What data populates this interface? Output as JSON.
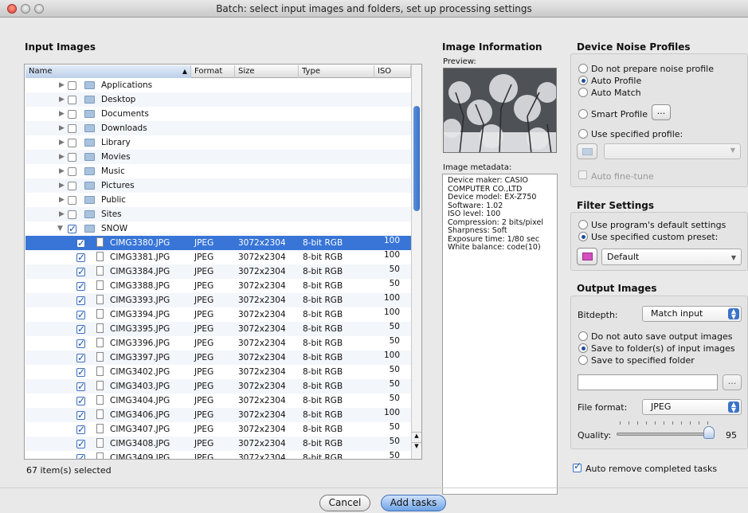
{
  "window": {
    "title": "Batch: select input images and folders, set up processing settings"
  },
  "input_images": {
    "title": "Input Images",
    "columns": [
      "Name",
      "Format",
      "Size",
      "Type",
      "ISO"
    ],
    "folders": [
      {
        "name": "Applications"
      },
      {
        "name": "Desktop"
      },
      {
        "name": "Documents"
      },
      {
        "name": "Downloads"
      },
      {
        "name": "Library"
      },
      {
        "name": "Movies"
      },
      {
        "name": "Music"
      },
      {
        "name": "Pictures"
      },
      {
        "name": "Public"
      },
      {
        "name": "Sites"
      },
      {
        "name": "SNOW"
      }
    ],
    "files": [
      {
        "name": "CIMG3380.JPG",
        "format": "JPEG",
        "size": "3072x2304",
        "type": "8-bit RGB",
        "iso": "100"
      },
      {
        "name": "CIMG3381.JPG",
        "format": "JPEG",
        "size": "3072x2304",
        "type": "8-bit RGB",
        "iso": "100"
      },
      {
        "name": "CIMG3384.JPG",
        "format": "JPEG",
        "size": "3072x2304",
        "type": "8-bit RGB",
        "iso": "50"
      },
      {
        "name": "CIMG3388.JPG",
        "format": "JPEG",
        "size": "3072x2304",
        "type": "8-bit RGB",
        "iso": "50"
      },
      {
        "name": "CIMG3393.JPG",
        "format": "JPEG",
        "size": "3072x2304",
        "type": "8-bit RGB",
        "iso": "100"
      },
      {
        "name": "CIMG3394.JPG",
        "format": "JPEG",
        "size": "3072x2304",
        "type": "8-bit RGB",
        "iso": "100"
      },
      {
        "name": "CIMG3395.JPG",
        "format": "JPEG",
        "size": "3072x2304",
        "type": "8-bit RGB",
        "iso": "50"
      },
      {
        "name": "CIMG3396.JPG",
        "format": "JPEG",
        "size": "3072x2304",
        "type": "8-bit RGB",
        "iso": "50"
      },
      {
        "name": "CIMG3397.JPG",
        "format": "JPEG",
        "size": "3072x2304",
        "type": "8-bit RGB",
        "iso": "100"
      },
      {
        "name": "CIMG3402.JPG",
        "format": "JPEG",
        "size": "3072x2304",
        "type": "8-bit RGB",
        "iso": "50"
      },
      {
        "name": "CIMG3403.JPG",
        "format": "JPEG",
        "size": "3072x2304",
        "type": "8-bit RGB",
        "iso": "50"
      },
      {
        "name": "CIMG3404.JPG",
        "format": "JPEG",
        "size": "3072x2304",
        "type": "8-bit RGB",
        "iso": "50"
      },
      {
        "name": "CIMG3406.JPG",
        "format": "JPEG",
        "size": "3072x2304",
        "type": "8-bit RGB",
        "iso": "100"
      },
      {
        "name": "CIMG3407.JPG",
        "format": "JPEG",
        "size": "3072x2304",
        "type": "8-bit RGB",
        "iso": "50"
      },
      {
        "name": "CIMG3408.JPG",
        "format": "JPEG",
        "size": "3072x2304",
        "type": "8-bit RGB",
        "iso": "50"
      }
    ],
    "partial_row": {
      "name": "CIMG3409.JPG",
      "format": "JPEG",
      "size": "3072x2304",
      "type": "8-bit RGB",
      "iso": "50"
    },
    "status": "67 item(s) selected"
  },
  "image_info": {
    "title": "Image Information",
    "preview_label": "Preview:",
    "metadata_label": "Image metadata:",
    "metadata": [
      "Device maker: CASIO",
      "COMPUTER CO.,LTD",
      "Device model: EX-Z750",
      "Software: 1.02",
      "ISO level: 100",
      "Compression: 2 bits/pixel",
      "Sharpness: Soft",
      "Exposure time: 1/80 sec",
      "White balance: code(10)"
    ]
  },
  "noise": {
    "title": "Device Noise Profiles",
    "options": [
      "Do not prepare noise profile",
      "Auto Profile",
      "Auto Match"
    ],
    "smart_profile": "Smart Profile",
    "use_specified": "Use specified profile:",
    "ellipsis": "...",
    "auto_fine_tune": "Auto fine-tune"
  },
  "filter": {
    "title": "Filter Settings",
    "options": [
      "Use program's default settings",
      "Use specified custom preset:"
    ],
    "preset": "Default"
  },
  "output": {
    "title": "Output Images",
    "bitdepth_label": "Bitdepth:",
    "bitdepth_value": "Match input",
    "save_options": [
      "Do not auto save output images",
      "Save to folder(s) of input images",
      "Save to specified folder"
    ],
    "folder_path": "",
    "browse": "...",
    "format_label": "File format:",
    "format_value": "JPEG",
    "quality_label": "Quality:",
    "quality_value": "95",
    "quality_fraction": 0.95,
    "auto_remove": "Auto remove completed tasks"
  },
  "buttons": {
    "cancel": "Cancel",
    "add_tasks": "Add tasks"
  },
  "colors": {
    "selection": "#3875d7",
    "accent": "#3b73c8"
  }
}
